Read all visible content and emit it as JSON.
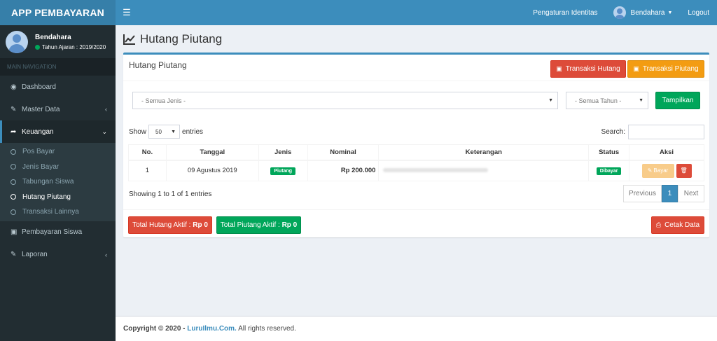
{
  "app": {
    "title": "APP PEMBAYARAN"
  },
  "navbar": {
    "toggle_icon": "hamburger-icon",
    "links": {
      "pengaturan": "Pengaturan Identitas",
      "user": "Bendahara",
      "logout": "Logout"
    }
  },
  "sidebar": {
    "user": {
      "name": "Bendahara",
      "status": "Tahun Ajaran : 2019/2020",
      "status_color": "#00a65a"
    },
    "header": "MAIN NAVIGATION",
    "items": {
      "dashboard": {
        "label": "Dashboard",
        "icon": "dashboard-icon"
      },
      "master": {
        "label": "Master Data",
        "icon": "edit-icon"
      },
      "keuangan": {
        "label": "Keuangan",
        "icon": "share-icon"
      },
      "pembayaran": {
        "label": "Pembayaran Siswa",
        "icon": "money-icon"
      },
      "laporan": {
        "label": "Laporan",
        "icon": "edit-icon"
      }
    },
    "submenu": {
      "pos": "Pos Bayar",
      "jenis": "Jenis Bayar",
      "tabungan": "Tabungan Siswa",
      "hutang": "Hutang Piutang",
      "lainnya": "Transaksi Lainnya"
    }
  },
  "page": {
    "title": "Hutang Piutang",
    "icon": "line-chart-icon"
  },
  "box": {
    "title": "Hutang Piutang",
    "btn_hutang": "Transaksi Hutang",
    "btn_piutang": "Transaksi Piutang",
    "filter_jenis": "- Semua Jenis -",
    "filter_tahun": "- Semua Tahun -",
    "btn_tampilkan": "Tampilkan",
    "show_label": "Show",
    "show_value": "50",
    "entries_label": "entries",
    "search_label": "Search:",
    "search_value": ""
  },
  "table": {
    "headers": {
      "no": "No.",
      "tanggal": "Tanggal",
      "jenis": "Jenis",
      "nominal": "Nominal",
      "keterangan": "Keterangan",
      "status": "Status",
      "aksi": "Aksi"
    },
    "rows": [
      {
        "no": "1",
        "tanggal": "09 Agustus 2019",
        "jenis": "Piutang",
        "nominal": "Rp 200.000",
        "status": "Dibayar",
        "bayar_label": "Bayar"
      }
    ]
  },
  "pagination": {
    "info": "Showing 1 to 1 of 1 entries",
    "previous": "Previous",
    "current": "1",
    "next": "Next"
  },
  "summary": {
    "hutang_label": "Total Hutang Aktif : ",
    "hutang_value": "Rp 0",
    "piutang_label": "Total Piutang Aktif : ",
    "piutang_value": "Rp 0",
    "cetak": "Cetak Data"
  },
  "footer": {
    "copyright": "Copyright © 2020 - ",
    "link": "LuruIlmu.Com.",
    "rights": " All rights reserved."
  },
  "colors": {
    "primary": "#3c8dbc",
    "sidebar": "#222d32",
    "danger": "#dd4b39",
    "warning": "#f39c12",
    "success": "#00a65a"
  }
}
